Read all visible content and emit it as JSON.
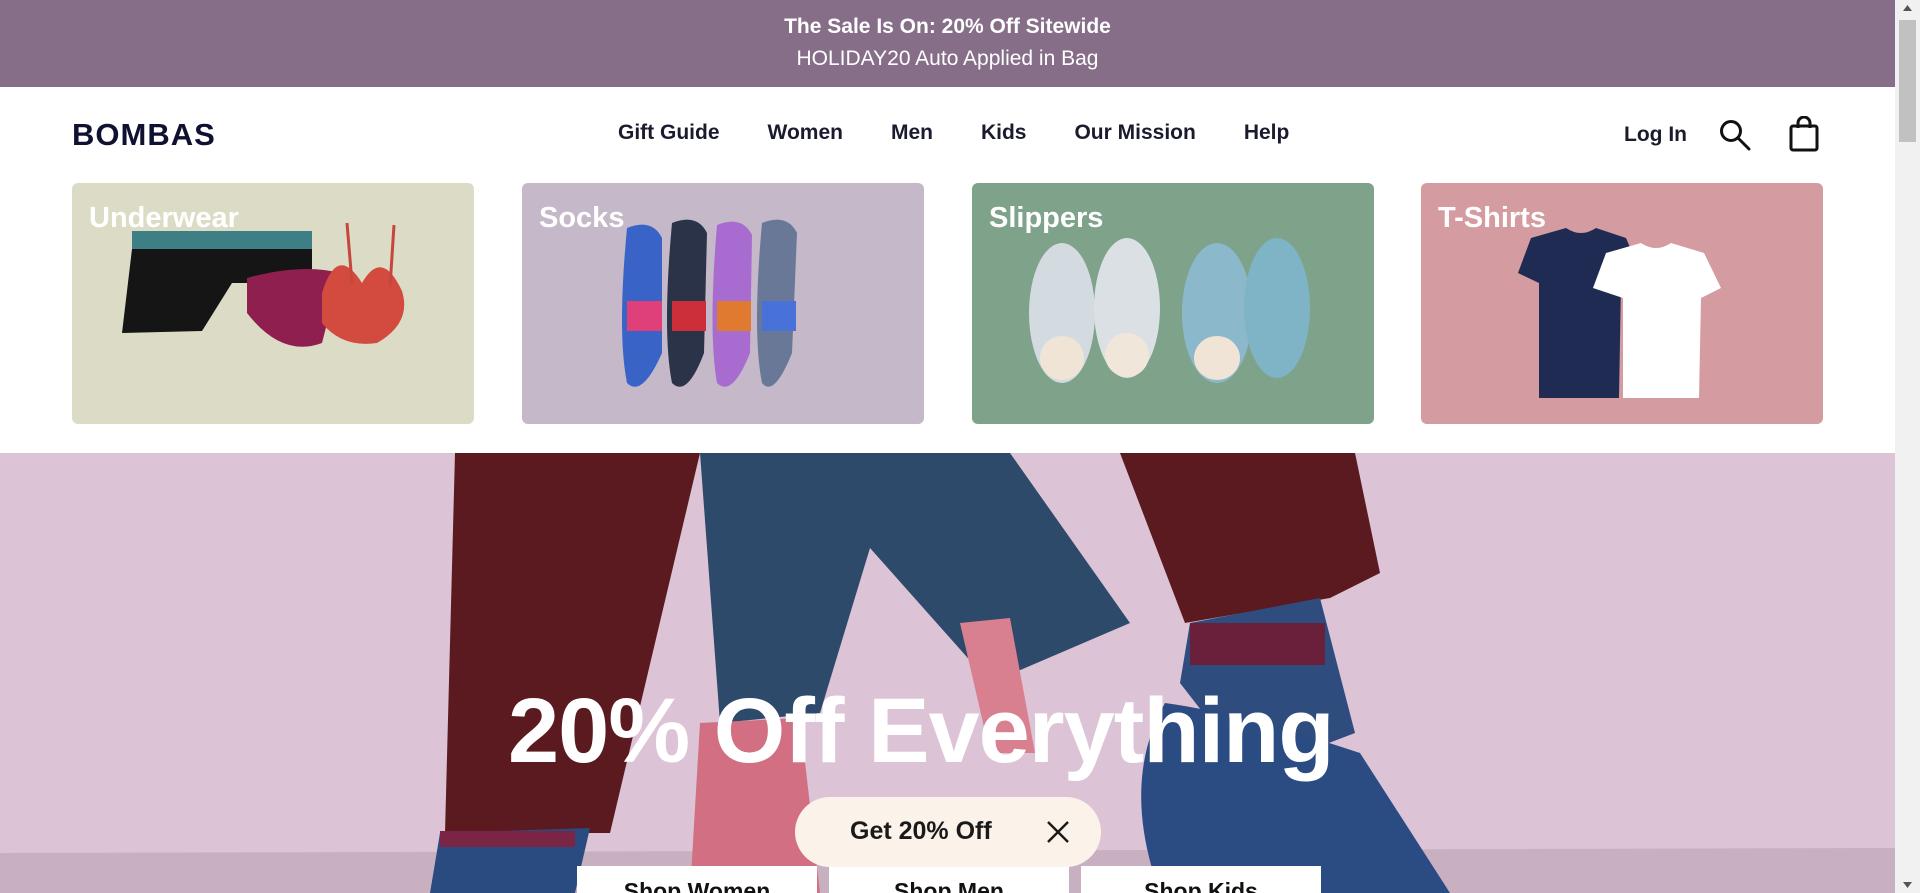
{
  "promo": {
    "headline": "The Sale Is On: 20% Off Sitewide",
    "subline": "HOLIDAY20 Auto Applied in Bag"
  },
  "header": {
    "logo": "BOMBAS",
    "nav": [
      "Gift Guide",
      "Women",
      "Men",
      "Kids",
      "Our Mission",
      "Help"
    ],
    "login": "Log In",
    "icons": {
      "search": "search-icon",
      "bag": "shopping-bag-icon"
    }
  },
  "categories": [
    {
      "label": "Underwear",
      "bg": "#dcdcc6"
    },
    {
      "label": "Socks",
      "bg": "#c5b8c8"
    },
    {
      "label": "Slippers",
      "bg": "#7ea28a"
    },
    {
      "label": "T-Shirts",
      "bg": "#d49ba0"
    }
  ],
  "hero": {
    "title": "20% Off Everything",
    "buttons": [
      "Shop Women",
      "Shop Men",
      "Shop Kids"
    ],
    "bg": "#dcc3d5"
  },
  "offer": {
    "label": "Get 20% Off",
    "close_icon": "close-icon"
  }
}
